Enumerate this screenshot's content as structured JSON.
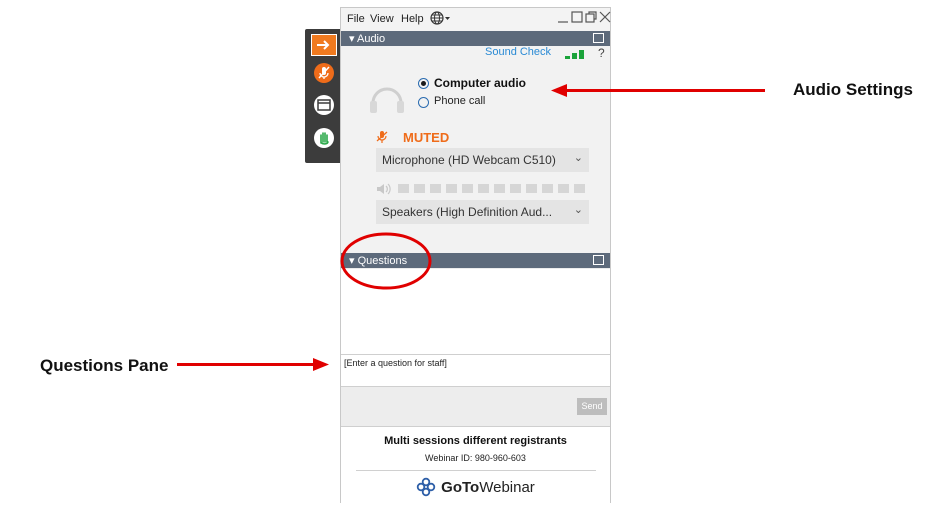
{
  "menu": {
    "file": "File",
    "view": "View",
    "help": "Help"
  },
  "audio_pane": {
    "title": "Audio",
    "sound_check": "Sound Check",
    "help_mark": "?",
    "computer_audio": "Computer audio",
    "phone_call": "Phone call",
    "muted": "MUTED",
    "microphone": "Microphone (HD Webcam C510)",
    "speakers": "Speakers (High Definition Aud..."
  },
  "questions_pane": {
    "title": "Questions",
    "input_placeholder": "[Enter a question for staff]",
    "send": "Send"
  },
  "session": {
    "name": "Multi sessions different registrants",
    "webinar_id": "Webinar ID: 980-960-603",
    "brand_goto": "GoTo",
    "brand_webinar": "Webinar"
  },
  "annotations": {
    "audio_settings": "Audio Settings",
    "questions_pane": "Questions Pane"
  },
  "colors": {
    "pane_header": "#5d6a7b",
    "muted_orange": "#ef6c1a",
    "sound_check_blue": "#2a8ad4",
    "signal_green": "#1aa33a",
    "annotation_red": "#e00000",
    "strip_bg": "#3c3c3c"
  }
}
